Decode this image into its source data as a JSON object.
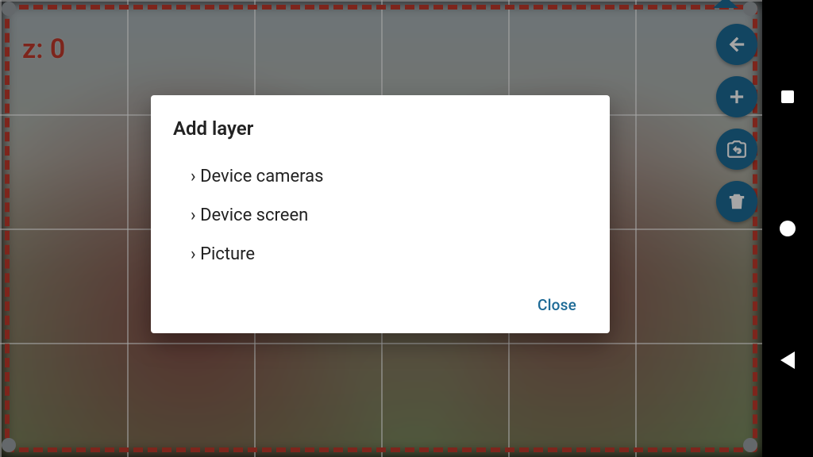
{
  "hud": {
    "z_label": "z: 0"
  },
  "fab": {
    "back": "back-icon",
    "add": "plus-icon",
    "swap": "camera-swap-icon",
    "delete": "trash-icon"
  },
  "dialog": {
    "title": "Add layer",
    "options": [
      "Device cameras",
      "Device screen",
      "Picture"
    ],
    "close_label": "Close"
  },
  "android_nav": {
    "recent": "recent-apps",
    "home": "home",
    "back": "back"
  }
}
